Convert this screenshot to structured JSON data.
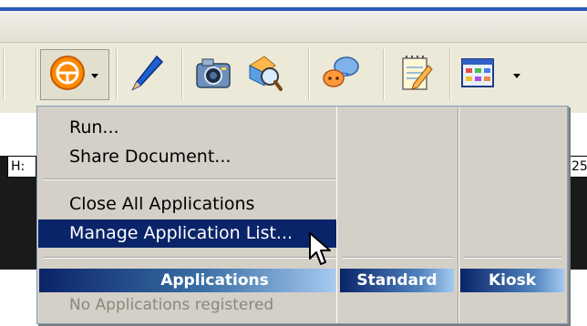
{
  "toolbar": {
    "icons": [
      "program-icon",
      "pen-icon",
      "camera-icon",
      "web-search-icon",
      "chat-icon",
      "notepad-icon",
      "grid-icon"
    ]
  },
  "background": {
    "left_tab_text": "H:",
    "right_tab_text": "25"
  },
  "menu": {
    "items": [
      {
        "label": "Run..."
      },
      {
        "label": "Share Document..."
      },
      {
        "label": "Close All Applications"
      },
      {
        "label": "Manage Application List..."
      }
    ],
    "active_index": 3,
    "headers": {
      "applications": "Applications",
      "standard": "Standard",
      "kiosk": "Kiosk"
    },
    "empty_text": "No Applications registered"
  },
  "colors": {
    "highlight": "#0a246a",
    "menu_bg": "#d4d0c8",
    "toolbar_bg": "#ece9d8"
  }
}
